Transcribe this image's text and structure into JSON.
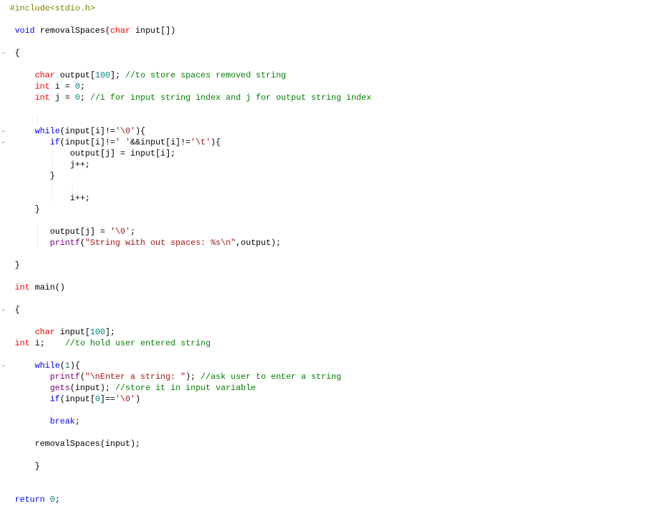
{
  "code": {
    "lines": [
      {
        "gutter": "",
        "tokens": [
          {
            "cls": "tok-preproc",
            "t": "#include<stdio.h>"
          }
        ]
      },
      {
        "gutter": "",
        "tokens": []
      },
      {
        "gutter": "",
        "tokens": [
          {
            "t": " "
          },
          {
            "cls": "tok-keyword",
            "t": "void"
          },
          {
            "t": " removalSpaces("
          },
          {
            "cls": "tok-type",
            "t": "char"
          },
          {
            "t": " input[])"
          }
        ]
      },
      {
        "gutter": "",
        "tokens": []
      },
      {
        "gutter": "-",
        "tokens": [
          {
            "t": " {"
          }
        ]
      },
      {
        "gutter": "",
        "tokens": []
      },
      {
        "gutter": "",
        "tokens": [
          {
            "t": "     "
          },
          {
            "cls": "tok-type",
            "t": "char"
          },
          {
            "t": " output["
          },
          {
            "cls": "tok-number",
            "t": "100"
          },
          {
            "t": "]; "
          },
          {
            "cls": "tok-comment",
            "t": "//to store spaces removed string"
          }
        ]
      },
      {
        "gutter": "",
        "tokens": [
          {
            "t": "     "
          },
          {
            "cls": "tok-type",
            "t": "int"
          },
          {
            "t": " i = "
          },
          {
            "cls": "tok-number",
            "t": "0"
          },
          {
            "t": ";"
          }
        ]
      },
      {
        "gutter": "",
        "tokens": [
          {
            "t": "     "
          },
          {
            "cls": "tok-type",
            "t": "int"
          },
          {
            "t": " j = "
          },
          {
            "cls": "tok-number",
            "t": "0"
          },
          {
            "t": "; "
          },
          {
            "cls": "tok-comment",
            "t": "//i for input string index and j for output string index"
          }
        ]
      },
      {
        "gutter": "",
        "tokens": []
      },
      {
        "gutter": "",
        "tokens": [
          {
            "t": "     "
          },
          {
            "cls": "guide",
            "t": "|"
          }
        ]
      },
      {
        "gutter": "-",
        "tokens": [
          {
            "t": "     "
          },
          {
            "cls": "tok-keyword",
            "t": "while"
          },
          {
            "t": "(input[i]!="
          },
          {
            "cls": "tok-string",
            "t": "'\\0'"
          },
          {
            "t": "){"
          }
        ]
      },
      {
        "gutter": "-",
        "tokens": [
          {
            "t": "        "
          },
          {
            "cls": "tok-keyword",
            "t": "if"
          },
          {
            "t": "(input[i]!="
          },
          {
            "cls": "tok-string",
            "t": "' '"
          },
          {
            "t": "&&input[i]!="
          },
          {
            "cls": "tok-string",
            "t": "'\\t'"
          },
          {
            "t": "){"
          }
        ]
      },
      {
        "gutter": "",
        "tokens": [
          {
            "t": "        "
          },
          {
            "cls": "guide",
            "t": "|"
          },
          {
            "t": "   output[j] = input[i];"
          }
        ]
      },
      {
        "gutter": "",
        "tokens": [
          {
            "t": "        "
          },
          {
            "cls": "guide",
            "t": "|"
          },
          {
            "t": "   j++;"
          }
        ]
      },
      {
        "gutter": "",
        "tokens": [
          {
            "t": "        }"
          }
        ]
      },
      {
        "gutter": "",
        "tokens": [
          {
            "t": "        "
          },
          {
            "cls": "guide",
            "t": "|   |"
          }
        ]
      },
      {
        "gutter": "",
        "tokens": [
          {
            "t": "        "
          },
          {
            "cls": "guide",
            "t": "|"
          },
          {
            "t": "   i++;"
          }
        ]
      },
      {
        "gutter": "",
        "tokens": [
          {
            "t": "     }"
          }
        ]
      },
      {
        "gutter": "",
        "tokens": []
      },
      {
        "gutter": "",
        "tokens": [
          {
            "t": "     "
          },
          {
            "cls": "guide",
            "t": "|"
          },
          {
            "t": "  output[j] = "
          },
          {
            "cls": "tok-string",
            "t": "'\\0'"
          },
          {
            "t": ";"
          }
        ]
      },
      {
        "gutter": "",
        "tokens": [
          {
            "t": "     "
          },
          {
            "cls": "guide",
            "t": "|"
          },
          {
            "t": "  "
          },
          {
            "cls": "tok-func",
            "t": "printf"
          },
          {
            "t": "("
          },
          {
            "cls": "tok-string",
            "t": "\"String with out spaces: %s\\n\""
          },
          {
            "t": ",output);"
          }
        ]
      },
      {
        "gutter": "",
        "tokens": []
      },
      {
        "gutter": "",
        "tokens": [
          {
            "t": " }"
          }
        ]
      },
      {
        "gutter": "",
        "tokens": []
      },
      {
        "gutter": "",
        "tokens": [
          {
            "t": " "
          },
          {
            "cls": "tok-type",
            "t": "int"
          },
          {
            "t": " main()"
          }
        ]
      },
      {
        "gutter": "",
        "tokens": []
      },
      {
        "gutter": "-",
        "tokens": [
          {
            "t": " {"
          }
        ]
      },
      {
        "gutter": "",
        "tokens": []
      },
      {
        "gutter": "",
        "tokens": [
          {
            "t": "     "
          },
          {
            "cls": "tok-type",
            "t": "char"
          },
          {
            "t": " input["
          },
          {
            "cls": "tok-number",
            "t": "100"
          },
          {
            "t": "];"
          }
        ]
      },
      {
        "gutter": "",
        "tokens": [
          {
            "t": " "
          },
          {
            "cls": "tok-type",
            "t": "int"
          },
          {
            "t": " i;    "
          },
          {
            "cls": "tok-comment",
            "t": "//to hold user entered string"
          }
        ]
      },
      {
        "gutter": "",
        "tokens": []
      },
      {
        "gutter": "-",
        "tokens": [
          {
            "t": "     "
          },
          {
            "cls": "tok-keyword",
            "t": "while"
          },
          {
            "t": "("
          },
          {
            "cls": "tok-number",
            "t": "1"
          },
          {
            "t": "){"
          }
        ]
      },
      {
        "gutter": "",
        "tokens": [
          {
            "t": "        "
          },
          {
            "cls": "tok-func",
            "t": "printf"
          },
          {
            "t": "("
          },
          {
            "cls": "tok-string",
            "t": "\"\\nEnter a string: \""
          },
          {
            "t": "); "
          },
          {
            "cls": "tok-comment",
            "t": "//ask user to enter a string"
          }
        ]
      },
      {
        "gutter": "",
        "tokens": [
          {
            "t": "        "
          },
          {
            "cls": "tok-func",
            "t": "gets"
          },
          {
            "t": "(input); "
          },
          {
            "cls": "tok-comment",
            "t": "//store it in input variable"
          }
        ]
      },
      {
        "gutter": "",
        "tokens": [
          {
            "t": "        "
          },
          {
            "cls": "tok-keyword",
            "t": "if"
          },
          {
            "t": "(input["
          },
          {
            "cls": "tok-number",
            "t": "0"
          },
          {
            "t": "]=="
          },
          {
            "cls": "tok-string",
            "t": "'\\0'"
          },
          {
            "t": ")"
          }
        ]
      },
      {
        "gutter": "",
        "tokens": [
          {
            "t": "        "
          },
          {
            "cls": "guide",
            "t": "|"
          }
        ]
      },
      {
        "gutter": "",
        "tokens": [
          {
            "t": "        "
          },
          {
            "cls": "tok-keyword",
            "t": "break"
          },
          {
            "t": ";"
          }
        ]
      },
      {
        "gutter": "",
        "tokens": []
      },
      {
        "gutter": "",
        "tokens": [
          {
            "t": "     removalSpaces(input);"
          }
        ]
      },
      {
        "gutter": "",
        "tokens": []
      },
      {
        "gutter": "",
        "tokens": [
          {
            "t": "     }"
          }
        ]
      },
      {
        "gutter": "",
        "tokens": []
      },
      {
        "gutter": "",
        "tokens": []
      },
      {
        "gutter": "",
        "tokens": [
          {
            "t": " "
          },
          {
            "cls": "tok-keyword",
            "t": "return"
          },
          {
            "t": " "
          },
          {
            "cls": "tok-number",
            "t": "0"
          },
          {
            "t": ";"
          }
        ]
      }
    ]
  }
}
